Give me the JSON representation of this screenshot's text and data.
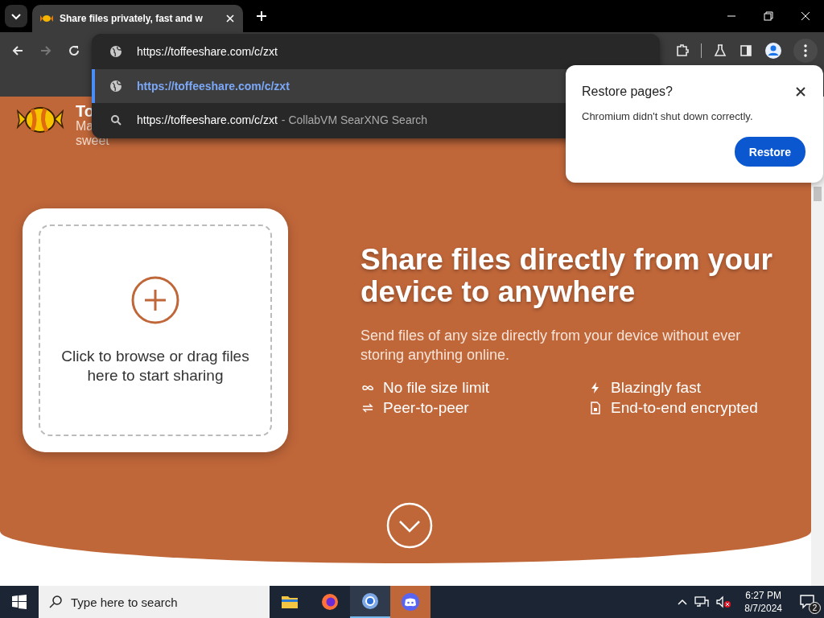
{
  "browser": {
    "tab": {
      "title": "Share files privately, fast and w",
      "selected": true
    },
    "omnibox": {
      "value": "https://toffeeshare.com/c/zxt"
    },
    "suggestions": [
      {
        "kind": "url",
        "text": "https://toffeeshare.com/c/zxt",
        "selected": true
      },
      {
        "kind": "search",
        "text": "https://toffeeshare.com/c/zxt",
        "suffix": "- CollabVM SearXNG Search",
        "selected": false
      }
    ]
  },
  "restore_popup": {
    "title": "Restore pages?",
    "message": "Chromium didn't shut down correctly.",
    "button": "Restore"
  },
  "page": {
    "brand": {
      "name": "To",
      "tagline_1": "Ma",
      "tagline_2": "sweet"
    },
    "dropzone": {
      "text": "Click to browse or drag files here to start sharing"
    },
    "headline": "Share files directly from your device to anywhere",
    "subtitle": "Send files of any size directly from your device without ever storing anything online.",
    "features": [
      {
        "kind": "infinity",
        "text": "No file size limit"
      },
      {
        "kind": "bolt",
        "text": "Blazingly fast"
      },
      {
        "kind": "swap",
        "text": "Peer-to-peer"
      },
      {
        "kind": "lock",
        "text": "End-to-end encrypted"
      }
    ]
  },
  "taskbar": {
    "search_placeholder": "Type here to search",
    "apps": [
      {
        "kind": "folder",
        "selected": false
      },
      {
        "kind": "firefox",
        "selected": false
      },
      {
        "kind": "chromium",
        "selected": true
      },
      {
        "kind": "discord",
        "selected": false
      }
    ],
    "time": "6:27 PM",
    "date": "8/7/2024",
    "notifications": "2"
  }
}
